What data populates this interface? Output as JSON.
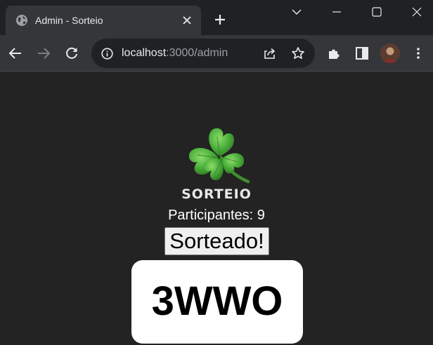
{
  "browser": {
    "tab": {
      "title": "Admin - Sorteio"
    },
    "address_bar": {
      "host": "localhost",
      "path": ":3000/admin"
    }
  },
  "page": {
    "brand": "SORTEIO",
    "participants_label": "Participantes: 9",
    "draw_button_label": "Sorteado!",
    "result_code": "3WWO"
  },
  "colors": {
    "page_background": "#232323",
    "browser_titlebar": "#202124",
    "browser_toolbar": "#35363a",
    "clover_green": "#4caf3c",
    "result_card": "#ffffff"
  },
  "icons": [
    "globe-icon",
    "close-icon",
    "plus-icon",
    "chevron-down-icon",
    "minimize-icon",
    "maximize-icon",
    "window-close-icon",
    "back-arrow-icon",
    "forward-arrow-icon",
    "reload-icon",
    "info-icon",
    "share-icon",
    "star-icon",
    "extensions-icon",
    "side-panel-icon",
    "avatar",
    "kebab-menu-icon",
    "clover-logo"
  ]
}
